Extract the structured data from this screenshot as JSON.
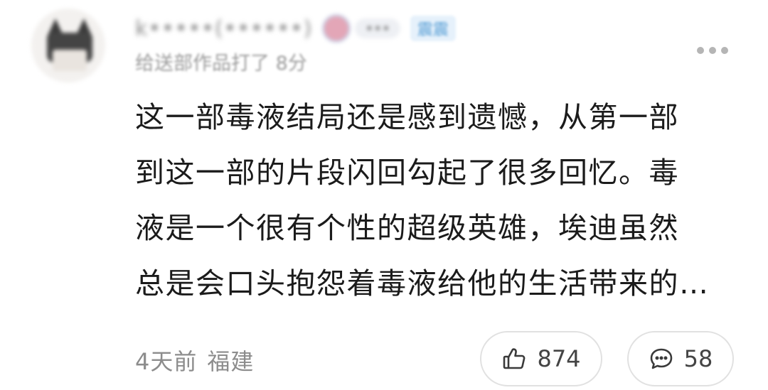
{
  "comment": {
    "author": {
      "name": "k•••••(••••••)",
      "avatar_icon": "bat-avatar-icon",
      "medal_label": "•••",
      "tag": "震震"
    },
    "sub_meta": "给送部作品打了 8分",
    "text_lines": [
      "这一部毒液结局还是感到遗憾，从第一部",
      "到这一部的片段闪回勾起了很多回忆。毒",
      "液是一个很有个性的超级英雄，埃迪虽然",
      "总是会口头抱怨着毒液给他的生活带来的…"
    ],
    "time_ago": "4天前",
    "location": "福建",
    "likes": "874",
    "replies": "58"
  },
  "icons": {
    "more": "more-dots-icon",
    "like": "thumb-up-icon",
    "reply": "chat-bubble-icon"
  },
  "colors": {
    "text": "#1b1b1b",
    "meta": "#8c8c8c",
    "tag_text": "#5aa0d6",
    "tag_bg": "#e6f1fb",
    "border": "#e1e1e1"
  }
}
